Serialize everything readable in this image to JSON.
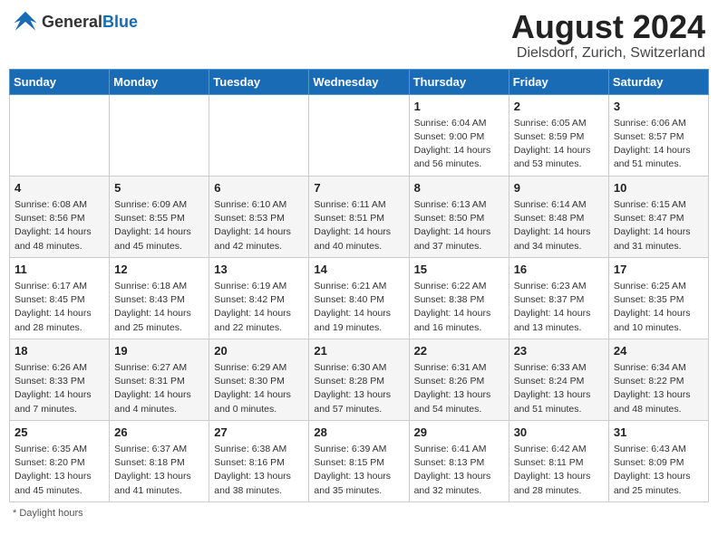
{
  "header": {
    "logo_general": "General",
    "logo_blue": "Blue",
    "month_title": "August 2024",
    "location": "Dielsdorf, Zurich, Switzerland"
  },
  "days_of_week": [
    "Sunday",
    "Monday",
    "Tuesday",
    "Wednesday",
    "Thursday",
    "Friday",
    "Saturday"
  ],
  "footer": {
    "note": "Daylight hours"
  },
  "weeks": [
    [
      {
        "day": "",
        "info": ""
      },
      {
        "day": "",
        "info": ""
      },
      {
        "day": "",
        "info": ""
      },
      {
        "day": "",
        "info": ""
      },
      {
        "day": "1",
        "info": "Sunrise: 6:04 AM\nSunset: 9:00 PM\nDaylight: 14 hours\nand 56 minutes."
      },
      {
        "day": "2",
        "info": "Sunrise: 6:05 AM\nSunset: 8:59 PM\nDaylight: 14 hours\nand 53 minutes."
      },
      {
        "day": "3",
        "info": "Sunrise: 6:06 AM\nSunset: 8:57 PM\nDaylight: 14 hours\nand 51 minutes."
      }
    ],
    [
      {
        "day": "4",
        "info": "Sunrise: 6:08 AM\nSunset: 8:56 PM\nDaylight: 14 hours\nand 48 minutes."
      },
      {
        "day": "5",
        "info": "Sunrise: 6:09 AM\nSunset: 8:55 PM\nDaylight: 14 hours\nand 45 minutes."
      },
      {
        "day": "6",
        "info": "Sunrise: 6:10 AM\nSunset: 8:53 PM\nDaylight: 14 hours\nand 42 minutes."
      },
      {
        "day": "7",
        "info": "Sunrise: 6:11 AM\nSunset: 8:51 PM\nDaylight: 14 hours\nand 40 minutes."
      },
      {
        "day": "8",
        "info": "Sunrise: 6:13 AM\nSunset: 8:50 PM\nDaylight: 14 hours\nand 37 minutes."
      },
      {
        "day": "9",
        "info": "Sunrise: 6:14 AM\nSunset: 8:48 PM\nDaylight: 14 hours\nand 34 minutes."
      },
      {
        "day": "10",
        "info": "Sunrise: 6:15 AM\nSunset: 8:47 PM\nDaylight: 14 hours\nand 31 minutes."
      }
    ],
    [
      {
        "day": "11",
        "info": "Sunrise: 6:17 AM\nSunset: 8:45 PM\nDaylight: 14 hours\nand 28 minutes."
      },
      {
        "day": "12",
        "info": "Sunrise: 6:18 AM\nSunset: 8:43 PM\nDaylight: 14 hours\nand 25 minutes."
      },
      {
        "day": "13",
        "info": "Sunrise: 6:19 AM\nSunset: 8:42 PM\nDaylight: 14 hours\nand 22 minutes."
      },
      {
        "day": "14",
        "info": "Sunrise: 6:21 AM\nSunset: 8:40 PM\nDaylight: 14 hours\nand 19 minutes."
      },
      {
        "day": "15",
        "info": "Sunrise: 6:22 AM\nSunset: 8:38 PM\nDaylight: 14 hours\nand 16 minutes."
      },
      {
        "day": "16",
        "info": "Sunrise: 6:23 AM\nSunset: 8:37 PM\nDaylight: 14 hours\nand 13 minutes."
      },
      {
        "day": "17",
        "info": "Sunrise: 6:25 AM\nSunset: 8:35 PM\nDaylight: 14 hours\nand 10 minutes."
      }
    ],
    [
      {
        "day": "18",
        "info": "Sunrise: 6:26 AM\nSunset: 8:33 PM\nDaylight: 14 hours\nand 7 minutes."
      },
      {
        "day": "19",
        "info": "Sunrise: 6:27 AM\nSunset: 8:31 PM\nDaylight: 14 hours\nand 4 minutes."
      },
      {
        "day": "20",
        "info": "Sunrise: 6:29 AM\nSunset: 8:30 PM\nDaylight: 14 hours\nand 0 minutes."
      },
      {
        "day": "21",
        "info": "Sunrise: 6:30 AM\nSunset: 8:28 PM\nDaylight: 13 hours\nand 57 minutes."
      },
      {
        "day": "22",
        "info": "Sunrise: 6:31 AM\nSunset: 8:26 PM\nDaylight: 13 hours\nand 54 minutes."
      },
      {
        "day": "23",
        "info": "Sunrise: 6:33 AM\nSunset: 8:24 PM\nDaylight: 13 hours\nand 51 minutes."
      },
      {
        "day": "24",
        "info": "Sunrise: 6:34 AM\nSunset: 8:22 PM\nDaylight: 13 hours\nand 48 minutes."
      }
    ],
    [
      {
        "day": "25",
        "info": "Sunrise: 6:35 AM\nSunset: 8:20 PM\nDaylight: 13 hours\nand 45 minutes."
      },
      {
        "day": "26",
        "info": "Sunrise: 6:37 AM\nSunset: 8:18 PM\nDaylight: 13 hours\nand 41 minutes."
      },
      {
        "day": "27",
        "info": "Sunrise: 6:38 AM\nSunset: 8:16 PM\nDaylight: 13 hours\nand 38 minutes."
      },
      {
        "day": "28",
        "info": "Sunrise: 6:39 AM\nSunset: 8:15 PM\nDaylight: 13 hours\nand 35 minutes."
      },
      {
        "day": "29",
        "info": "Sunrise: 6:41 AM\nSunset: 8:13 PM\nDaylight: 13 hours\nand 32 minutes."
      },
      {
        "day": "30",
        "info": "Sunrise: 6:42 AM\nSunset: 8:11 PM\nDaylight: 13 hours\nand 28 minutes."
      },
      {
        "day": "31",
        "info": "Sunrise: 6:43 AM\nSunset: 8:09 PM\nDaylight: 13 hours\nand 25 minutes."
      }
    ]
  ]
}
